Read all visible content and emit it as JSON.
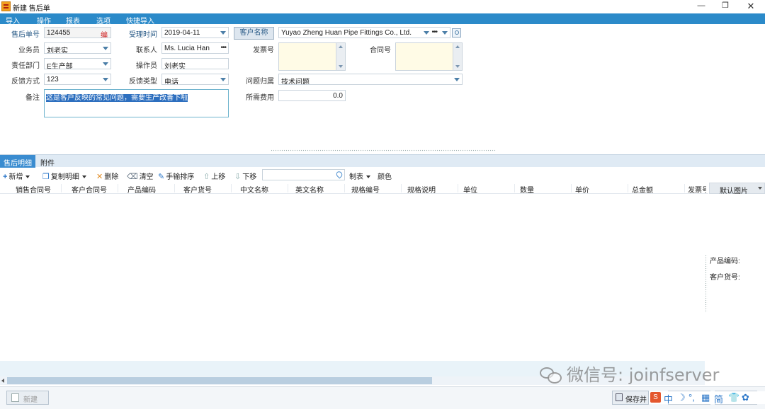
{
  "window": {
    "title": "新建 售后单",
    "min": "—",
    "max": "❐",
    "close": "✕"
  },
  "menu": [
    "导入",
    "操作",
    "报表",
    "选项",
    "快捷导入"
  ],
  "form": {
    "order_no": {
      "label": "售后单号",
      "value": "124455",
      "edit": "编"
    },
    "accept_time": {
      "label": "受理时间",
      "value": "2019-04-11"
    },
    "customer": {
      "button": "客户名称",
      "value": "Yuyao Zheng Huan Pipe Fittings Co., Ltd."
    },
    "salesman": {
      "label": "业务员",
      "value": "刘老实"
    },
    "contact": {
      "label": "联系人",
      "value": "Ms. Lucia Han"
    },
    "invoice_no": {
      "label": "发票号"
    },
    "contract_no": {
      "label": "合同号"
    },
    "dept": {
      "label": "责任部门",
      "value": "E生产部"
    },
    "operator": {
      "label": "操作员",
      "value": "刘老实"
    },
    "feedback_method": {
      "label": "反馈方式",
      "value": "123"
    },
    "feedback_type": {
      "label": "反馈类型",
      "value": "电话"
    },
    "issue_category": {
      "label": "问题归属",
      "value": "技术问题"
    },
    "remark": {
      "label": "备注",
      "value": "这是客户反映的常见问题，需要生产改善下啦"
    },
    "cost": {
      "label": "所需费用",
      "value": "0.0"
    }
  },
  "tabs": [
    "售后明细",
    "附件"
  ],
  "toolbar": {
    "add": "新增",
    "copy": "复制明细",
    "delete": "删除",
    "clear": "清空",
    "manual_sort": "手输排序",
    "move_up": "上移",
    "move_down": "下移",
    "tabulate": "制表",
    "color": "颜色"
  },
  "grid": {
    "columns": [
      "销售合同号",
      "客户合同号",
      "产品编码",
      "客户货号",
      "中文名称",
      "英文名称",
      "规格编号",
      "规格说明",
      "单位",
      "数量",
      "单价",
      "总金额",
      "发票号"
    ]
  },
  "image_pane": {
    "header": "默认图片",
    "product_code": "产品编码:",
    "customer_item": "客户货号:"
  },
  "watermark": "微信号: joinfserver",
  "bottom": {
    "new": "新建",
    "save": "保存并",
    "ime": [
      "中",
      "☽",
      "°,",
      "▦",
      "简",
      "👕",
      "✿"
    ]
  },
  "colors": {
    "menu_bg": "#2b8ac9",
    "tab_active": "#3a8cd0",
    "selection": "#2d6fbf"
  }
}
